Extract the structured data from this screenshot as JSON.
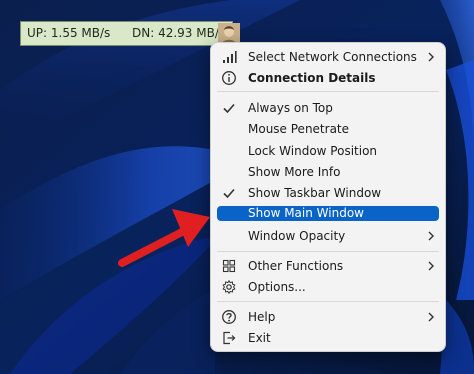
{
  "widget": {
    "up_text": "UP: 1.55 MB/s",
    "dn_text": "DN: 42.93 MB/s"
  },
  "menu": {
    "items": [
      {
        "label": "Select Network Connections",
        "icon": "signal-bars-icon",
        "submenu": true
      },
      {
        "label": "Connection Details",
        "icon": "info-icon",
        "bold": true
      },
      {
        "label": "Always on Top",
        "icon": "checkmark-icon"
      },
      {
        "label": "Mouse Penetrate"
      },
      {
        "label": "Lock Window Position"
      },
      {
        "label": "Show More Info"
      },
      {
        "label": "Show Taskbar Window",
        "icon": "checkmark-icon"
      },
      {
        "label": "Show Main Window",
        "highlighted": true
      },
      {
        "label": "Window Opacity",
        "submenu": true
      },
      {
        "label": "Other Functions",
        "icon": "grid-icon",
        "submenu": true
      },
      {
        "label": "Options...",
        "icon": "gear-icon"
      },
      {
        "label": "Help",
        "icon": "help-icon",
        "submenu": true
      },
      {
        "label": "Exit",
        "icon": "exit-icon"
      }
    ]
  },
  "colors": {
    "highlight": "#0a64c8",
    "arrow": "#e02020",
    "widget_bg": "#d8e8c8"
  }
}
